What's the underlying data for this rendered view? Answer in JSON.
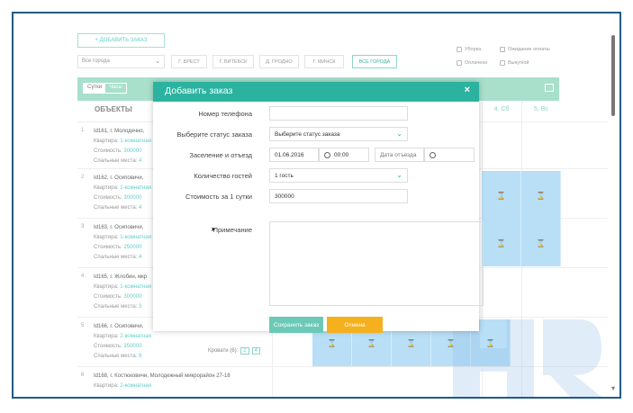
{
  "toolbar": {
    "add_order_label": "+ ДОБАВИТЬ ЗАКАЗ"
  },
  "filters": {
    "city_select": "Все города",
    "cities": [
      "Г. БРЕСТ",
      "Г. ВИТЕБСК",
      "Д. ГРОДНО",
      "Г. МИНСК",
      "ВСЕ ГОРОДА"
    ]
  },
  "legend": {
    "item1": "Уборка",
    "item2": "Ожидание оплаты",
    "item3": "Оплачено",
    "item4": "Выкуп/ой"
  },
  "view_toggle": {
    "on": "Сутки",
    "off": "Часы"
  },
  "table": {
    "objects_header": "ОБЪЕКТЫ",
    "day_headers": [
      "4, Сб",
      "5, Вс"
    ],
    "rows": [
      {
        "num": "1",
        "title": "Id161, г. Молодечно,",
        "k1": "Квартира:",
        "v1": "1-комнатная",
        "k2": "Стоимость:",
        "v2": "300000",
        "k3": "Спальные места:",
        "v3": "4"
      },
      {
        "num": "2",
        "title": "Id162, г. Осиповичи,",
        "k1": "Квартира:",
        "v1": "1-комнатная",
        "k2": "Стоимость:",
        "v2": "300000",
        "k3": "Спальные места:",
        "v3": "4"
      },
      {
        "num": "3",
        "title": "Id163, г. Осиповичи,",
        "k1": "Квартира:",
        "v1": "1-комнатная",
        "k2": "Стоимость:",
        "v2": "250000",
        "k3": "Спальные места:",
        "v3": "4"
      },
      {
        "num": "4",
        "title": "Id165, г. Жлобин, мкр",
        "k1": "Квартира:",
        "v1": "1-комнатная",
        "k2": "Стоимость:",
        "v2": "300000",
        "k3": "Спальные места:",
        "v3": "3"
      },
      {
        "num": "5",
        "title": "Id166, г. Осиповичи,",
        "k1": "Квартира:",
        "v1": "2-комнатная",
        "k2": "Стоимость:",
        "v2": "350000",
        "k3": "Спальные места:",
        "v3": "8"
      },
      {
        "num": "6",
        "title": "Id168, г. Костюковичи, Молодежный микрорайон 27-18",
        "k1": "Квартира:",
        "v1": "2-комнатная"
      }
    ],
    "beds_label": "Кровати (6):",
    "beds_values": [
      "2",
      "4"
    ]
  },
  "modal": {
    "title": "Добавить заказ",
    "close": "×",
    "fields": {
      "phone_label": "Номер телефона",
      "phone_value": "",
      "status_label": "Выберите статус заказа",
      "status_value": "Выберите статус заказа",
      "dates_label": "Заселение и отъезд",
      "checkin_date": "01.06.2016",
      "checkin_time": "00:00",
      "checkout_placeholder": "Дата отъезда",
      "guests_label": "Количество гостей",
      "guests_value": "1 гость",
      "price_label": "Стоимость за 1 сутки",
      "price_value": "300000",
      "note_label": "Примечание"
    },
    "save_label": "Сохранить заказ",
    "cancel_label": "Отмена"
  },
  "colors": {
    "accent": "#2bb3a0",
    "cancel": "#f5b01e",
    "booked": "#b8dff6"
  }
}
